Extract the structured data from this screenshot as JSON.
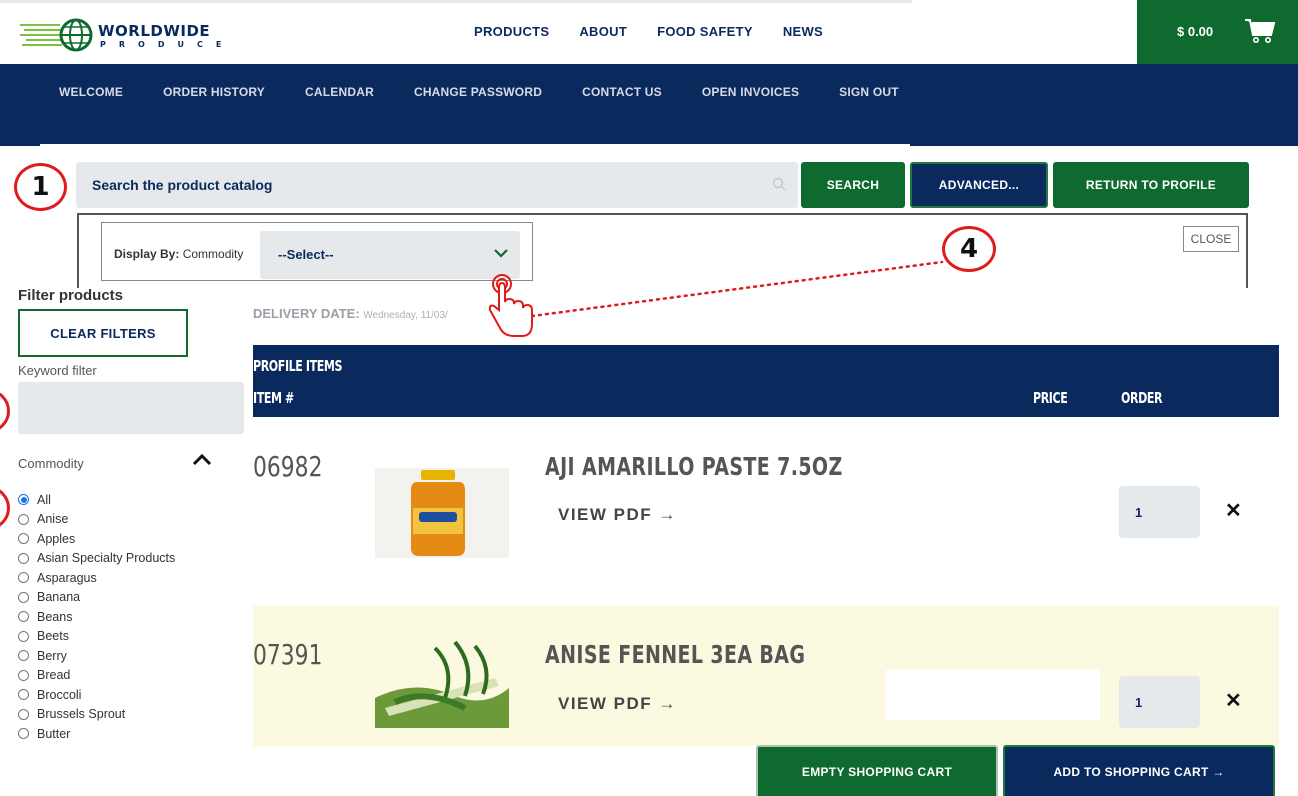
{
  "brand": {
    "name": "WORLDWIDE",
    "sub": "PRODUCE",
    "colors": {
      "navy": "#0a2a5e",
      "green": "#0f6a2f",
      "annotation": "#e01b1b"
    }
  },
  "top_nav": [
    "PRODUCTS",
    "ABOUT",
    "FOOD SAFETY",
    "NEWS"
  ],
  "cart": {
    "total": "$ 0.00",
    "icon": "shopping-cart-icon"
  },
  "sub_nav": [
    "WELCOME",
    "ORDER HISTORY",
    "CALENDAR",
    "CHANGE PASSWORD",
    "CONTACT US",
    "OPEN INVOICES",
    "SIGN OUT"
  ],
  "search": {
    "placeholder": "Search the product catalog",
    "search_label": "SEARCH",
    "advanced_label": "ADVANCED...",
    "return_label": "RETURN TO PROFILE"
  },
  "advanced": {
    "display_by_label": "Display By:",
    "display_by_value": "Commodity",
    "select_value": "--Select--",
    "close_label": "CLOSE"
  },
  "annotations": {
    "badge_1": "1",
    "badge_4": "4"
  },
  "filters": {
    "title": "Filter products",
    "clear_label": "CLEAR FILTERS",
    "keyword_label": "Keyword filter",
    "keyword_value": "",
    "commodity_label": "Commodity",
    "commodities": [
      "All",
      "Anise",
      "Apples",
      "Asian Specialty Products",
      "Asparagus",
      "Banana",
      "Beans",
      "Beets",
      "Berry",
      "Bread",
      "Broccoli",
      "Brussels Sprout",
      "Butter"
    ],
    "selected": "All"
  },
  "delivery": {
    "label": "DELIVERY DATE:",
    "date": "Wednesday, 11/03/"
  },
  "table": {
    "title": "PROFILE ITEMS",
    "col_item": "ITEM #",
    "col_price": "PRICE",
    "col_order": "ORDER",
    "rows": [
      {
        "item_no": "06982",
        "name": "AJI AMARILLO PASTE 7.5OZ",
        "pdf_label": "VIEW PDF →",
        "qty": "1",
        "remove": "✕"
      },
      {
        "item_no": "07391",
        "name": "ANISE FENNEL 3EA BAG",
        "pdf_label": "VIEW PDF →",
        "qty": "1",
        "remove": "✕"
      }
    ]
  },
  "actions": {
    "empty_label": "EMPTY SHOPPING CART",
    "add_label": "ADD TO SHOPPING CART →"
  }
}
